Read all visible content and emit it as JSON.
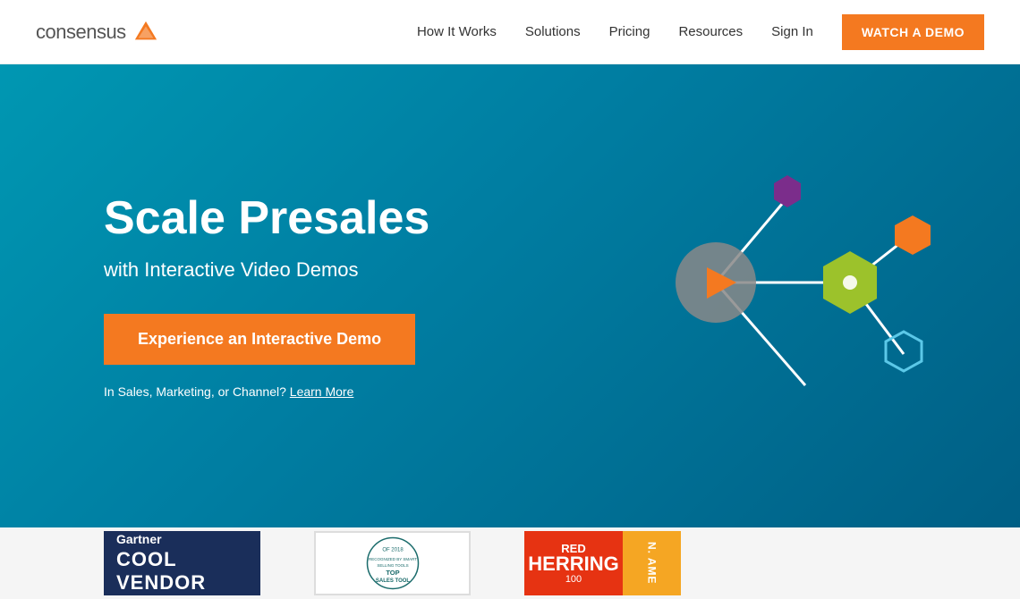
{
  "navbar": {
    "logo_text": "consensus",
    "nav_items": [
      {
        "label": "How It Works",
        "id": "how-it-works"
      },
      {
        "label": "Solutions",
        "id": "solutions"
      },
      {
        "label": "Pricing",
        "id": "pricing"
      },
      {
        "label": "Resources",
        "id": "resources"
      },
      {
        "label": "Sign In",
        "id": "sign-in"
      }
    ],
    "cta_label": "WATCH A DEMO"
  },
  "hero": {
    "title_line1": "Scale Presales",
    "subtitle": "with Interactive Video Demos",
    "cta_label": "Experience an Interactive Demo",
    "learn_more_prefix": "In Sales, Marketing, or Channel?",
    "learn_more_link": "Learn More"
  },
  "awards": {
    "gartner": {
      "brand": "Gartner",
      "label": "COOL",
      "label2": "VENDOR"
    },
    "sales_tool": {
      "year": "OF 2018",
      "recognized": "RECOGNIZED BY SMART SELLING TOOLS",
      "title": "TOP",
      "subtitle": "SALES TOOL"
    },
    "red_herring": {
      "top": "RED",
      "bottom": "HERRING",
      "sub": "100",
      "side": "N. AME"
    }
  }
}
